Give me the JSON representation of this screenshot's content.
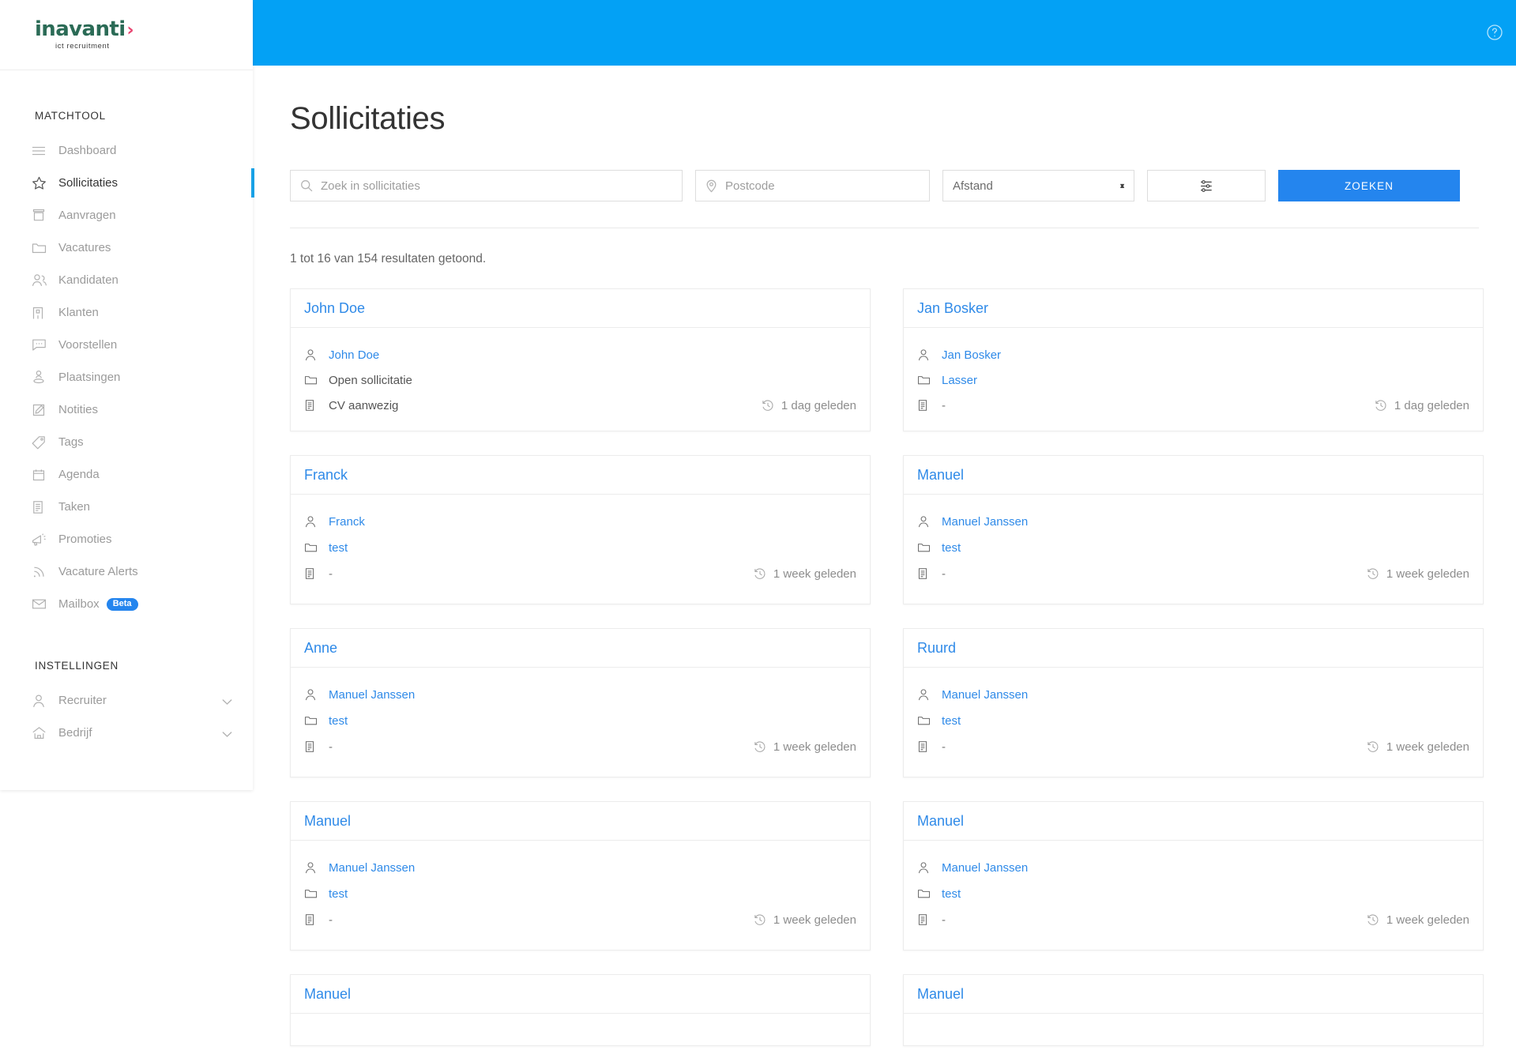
{
  "colors": {
    "header_blue": "#03a1f5",
    "button_blue": "#2485ee",
    "link_blue": "#2f8ae8",
    "logo_green": "#2b6b56",
    "logo_pink": "#e8436f"
  },
  "topbar": {
    "help_icon": "help-circle-icon"
  },
  "sidebar": {
    "logo": {
      "name": "inavanti",
      "chevron": "›",
      "tagline": "ict recruitment"
    },
    "sections": [
      {
        "title": "MATCHTOOL",
        "items": [
          {
            "label": "Dashboard",
            "icon": "menu-lines-icon",
            "active": false
          },
          {
            "label": "Sollicitaties",
            "icon": "star-icon",
            "active": true
          },
          {
            "label": "Aanvragen",
            "icon": "inbox-icon",
            "active": false
          },
          {
            "label": "Vacatures",
            "icon": "folder-icon",
            "active": false
          },
          {
            "label": "Kandidaten",
            "icon": "users-icon",
            "active": false
          },
          {
            "label": "Klanten",
            "icon": "building-icon",
            "active": false
          },
          {
            "label": "Voorstellen",
            "icon": "chat-bubble-icon",
            "active": false
          },
          {
            "label": "Plaatsingen",
            "icon": "pin-person-icon",
            "active": false
          },
          {
            "label": "Notities",
            "icon": "edit-note-icon",
            "active": false
          },
          {
            "label": "Tags",
            "icon": "tag-icon",
            "active": false
          },
          {
            "label": "Agenda",
            "icon": "calendar-icon",
            "active": false
          },
          {
            "label": "Taken",
            "icon": "document-list-icon",
            "active": false
          },
          {
            "label": "Promoties",
            "icon": "megaphone-icon",
            "active": false
          },
          {
            "label": "Vacature Alerts",
            "icon": "rss-icon",
            "active": false
          },
          {
            "label": "Mailbox",
            "icon": "envelope-icon",
            "active": false,
            "badge": "Beta"
          }
        ]
      },
      {
        "title": "INSTELLINGEN",
        "items": [
          {
            "label": "Recruiter",
            "icon": "person-icon",
            "active": false,
            "expandable": true
          },
          {
            "label": "Bedrijf",
            "icon": "home-icon",
            "active": false,
            "expandable": true
          }
        ]
      }
    ]
  },
  "main": {
    "page_title": "Sollicitaties",
    "search": {
      "query_value": "",
      "query_placeholder": "Zoek in sollicitaties",
      "query_icon": "search-icon",
      "postcode_value": "",
      "postcode_placeholder": "Postcode",
      "postcode_icon": "map-pin-icon",
      "distance_label": "Afstand",
      "distance_options": [
        "Afstand"
      ],
      "filter_icon": "sliders-icon",
      "submit_label": "ZOEKEN"
    },
    "results_count": "1 tot 16 van 154 resultaten getoond.",
    "cards": [
      {
        "title": "John Doe",
        "person": "John Doe",
        "person_icon": "person-icon",
        "person_is_link": true,
        "vacancy": "Open sollicitatie",
        "vacancy_icon": "folder-icon",
        "vacancy_is_link": false,
        "cv": "CV aanwezig",
        "cv_icon": "document-list-icon",
        "time": "1 dag geleden",
        "time_icon": "clock-history-icon",
        "tall": false
      },
      {
        "title": "Jan Bosker",
        "person": "Jan Bosker",
        "person_icon": "person-icon",
        "person_is_link": true,
        "vacancy": "Lasser",
        "vacancy_icon": "folder-icon",
        "vacancy_is_link": true,
        "cv": "-",
        "cv_icon": "document-list-icon",
        "time": "1 dag geleden",
        "time_icon": "clock-history-icon",
        "tall": false
      },
      {
        "title": "Franck",
        "person": "Franck",
        "person_icon": "person-icon",
        "person_is_link": true,
        "vacancy": "test",
        "vacancy_icon": "folder-icon",
        "vacancy_is_link": true,
        "cv": "-",
        "cv_icon": "document-list-icon",
        "time": "1 week geleden",
        "time_icon": "clock-history-icon",
        "tall": true
      },
      {
        "title": "Manuel",
        "person": "Manuel Janssen",
        "person_icon": "person-icon",
        "person_is_link": true,
        "vacancy": "test",
        "vacancy_icon": "folder-icon",
        "vacancy_is_link": true,
        "cv": "-",
        "cv_icon": "document-list-icon",
        "time": "1 week geleden",
        "time_icon": "clock-history-icon",
        "tall": true
      },
      {
        "title": "Anne",
        "person": "Manuel Janssen",
        "person_icon": "person-icon",
        "person_is_link": true,
        "vacancy": "test",
        "vacancy_icon": "folder-icon",
        "vacancy_is_link": true,
        "cv": "-",
        "cv_icon": "document-list-icon",
        "time": "1 week geleden",
        "time_icon": "clock-history-icon",
        "tall": true
      },
      {
        "title": "Ruurd",
        "person": "Manuel Janssen",
        "person_icon": "person-icon",
        "person_is_link": true,
        "vacancy": "test",
        "vacancy_icon": "folder-icon",
        "vacancy_is_link": true,
        "cv": "-",
        "cv_icon": "document-list-icon",
        "time": "1 week geleden",
        "time_icon": "clock-history-icon",
        "tall": true
      },
      {
        "title": "Manuel",
        "person": "Manuel Janssen",
        "person_icon": "person-icon",
        "person_is_link": true,
        "vacancy": "test",
        "vacancy_icon": "folder-icon",
        "vacancy_is_link": true,
        "cv": "-",
        "cv_icon": "document-list-icon",
        "time": "1 week geleden",
        "time_icon": "clock-history-icon",
        "tall": true
      },
      {
        "title": "Manuel",
        "person": "Manuel Janssen",
        "person_icon": "person-icon",
        "person_is_link": true,
        "vacancy": "test",
        "vacancy_icon": "folder-icon",
        "vacancy_is_link": true,
        "cv": "-",
        "cv_icon": "document-list-icon",
        "time": "1 week geleden",
        "time_icon": "clock-history-icon",
        "tall": true
      },
      {
        "title": "Manuel",
        "person": "",
        "person_icon": "person-icon",
        "person_is_link": true,
        "vacancy": "",
        "vacancy_icon": "folder-icon",
        "vacancy_is_link": true,
        "cv": "",
        "cv_icon": "document-list-icon",
        "time": "",
        "time_icon": "clock-history-icon",
        "tall": true
      },
      {
        "title": "Manuel",
        "person": "",
        "person_icon": "person-icon",
        "person_is_link": true,
        "vacancy": "",
        "vacancy_icon": "folder-icon",
        "vacancy_is_link": true,
        "cv": "",
        "cv_icon": "document-list-icon",
        "time": "",
        "time_icon": "clock-history-icon",
        "tall": true
      }
    ]
  }
}
